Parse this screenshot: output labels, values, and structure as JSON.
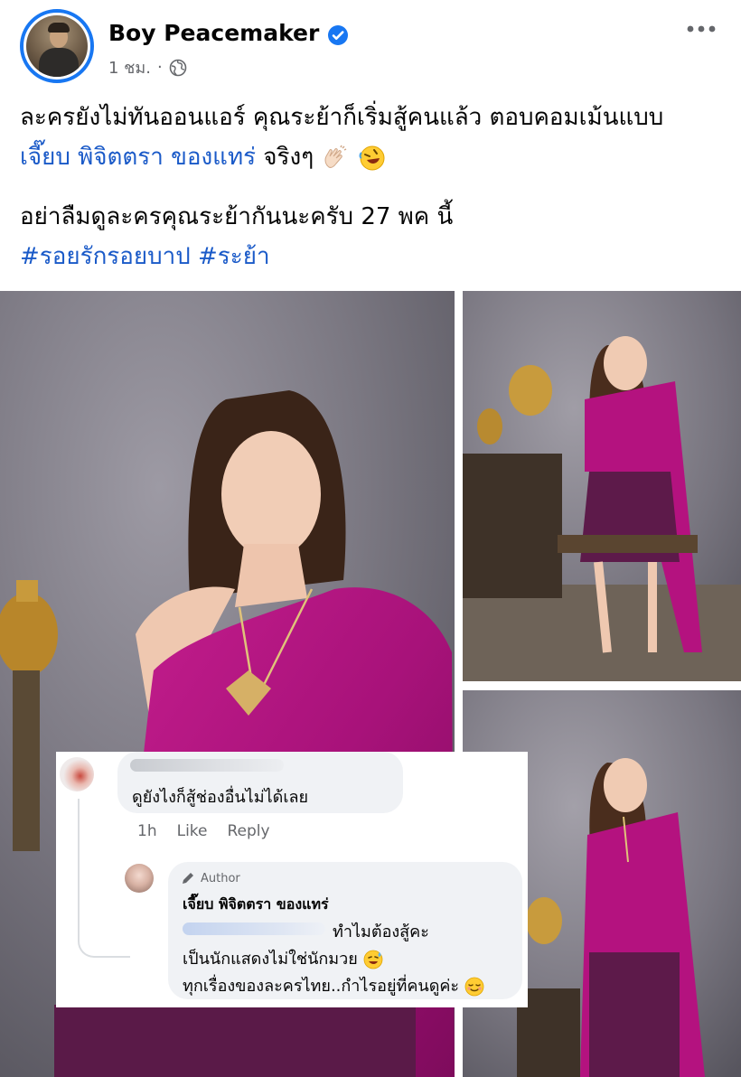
{
  "post": {
    "author_name": "Boy Peacemaker",
    "time": "1 ชม.",
    "separator": "·",
    "icons": {
      "verified": "verified-badge-icon",
      "audience": "globe-icon",
      "more": "more-options-icon"
    },
    "colors": {
      "accent": "#1877f2",
      "link": "#1a5ac8",
      "meta": "#65676b",
      "text": "#050505"
    }
  },
  "caption": {
    "line1": "ละครยังไม่ทันออนแอร์ คุณระย้าก็เริ่มสู้คนแล้ว ตอบคอมเม้นแบบ",
    "mention": "เจี๊ยบ พิจิตตรา ของแทร่",
    "line2_rest": " จริงๆ",
    "line3": "อย่าลืมดูละครคุณระย้ากันนะครับ 27 พค นี้",
    "hashtag1": "#รอยรักรอยบาป",
    "hashtag2": "#ระย้า"
  },
  "comments": {
    "first": {
      "text": "ดูยังไงก็สู้ช่องอื่นไม่ได้เลย",
      "time": "1h",
      "like": "Like",
      "reply": "Reply"
    },
    "reply": {
      "badge": "Author",
      "name": "เจี๊ยบ พิจิตตรา ของแทร่",
      "line1": "ทำไมต้องสู้คะ",
      "line2": "เป็นนักแสดงไม่ใช่นักมวย",
      "line3": "ทุกเรื่องของละครไทย..กำไรอยู่ที่คนดูค่ะ"
    }
  }
}
